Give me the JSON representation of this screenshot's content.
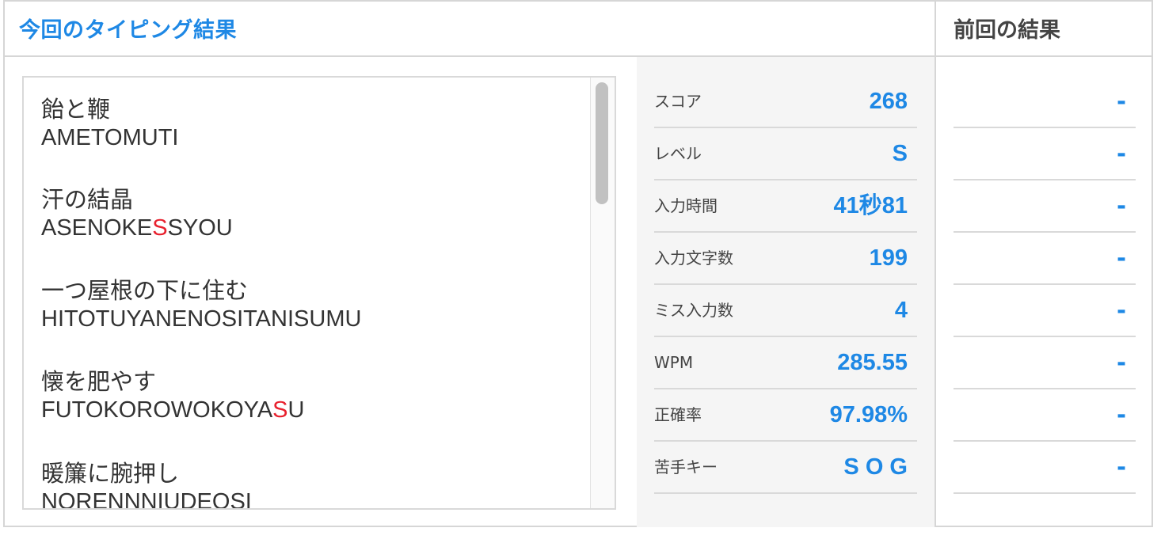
{
  "header": {
    "current_title": "今回のタイピング結果",
    "previous_title": "前回の結果"
  },
  "words": [
    {
      "jp": "飴と鞭",
      "romaji_parts": [
        {
          "t": "AMETOMUTI",
          "miss": false
        }
      ]
    },
    {
      "jp": "汗の結晶",
      "romaji_parts": [
        {
          "t": "ASENOKE",
          "miss": false
        },
        {
          "t": "S",
          "miss": true
        },
        {
          "t": "SYOU",
          "miss": false
        }
      ]
    },
    {
      "jp": "一つ屋根の下に住む",
      "romaji_parts": [
        {
          "t": "HITOTUYANENOSITANISUMU",
          "miss": false
        }
      ]
    },
    {
      "jp": "懐を肥やす",
      "romaji_parts": [
        {
          "t": "FUTOKOROWOKOYA",
          "miss": false
        },
        {
          "t": "S",
          "miss": true
        },
        {
          "t": "U",
          "miss": false
        }
      ]
    },
    {
      "jp": "暖簾に腕押し",
      "romaji_parts": [
        {
          "t": "NORENNNIUDEOSI",
          "miss": false
        }
      ]
    }
  ],
  "stats": [
    {
      "label": "スコア",
      "value": "268"
    },
    {
      "label": "レベル",
      "value": "S"
    },
    {
      "label": "入力時間",
      "value": "41秒81"
    },
    {
      "label": "入力文字数",
      "value": "199"
    },
    {
      "label": "ミス入力数",
      "value": "4"
    },
    {
      "label": "WPM",
      "value": "285.55"
    },
    {
      "label": "正確率",
      "value": "97.98%"
    },
    {
      "label": "苦手キー",
      "value": "S O G"
    }
  ],
  "previous": [
    "-",
    "-",
    "-",
    "-",
    "-",
    "-",
    "-",
    "-"
  ],
  "colors": {
    "accent": "#1e88e5",
    "miss": "#e8212e"
  }
}
